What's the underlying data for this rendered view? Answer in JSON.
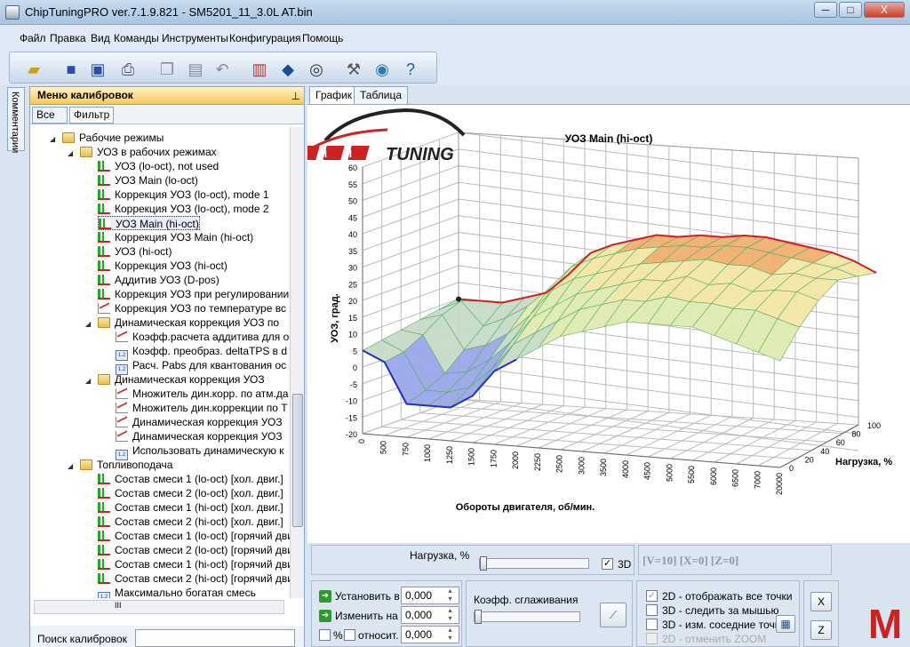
{
  "window": {
    "title": "ChipTuningPRO ver.7.1.9.821 - SM5201_11_3.0L AT.bin",
    "minimize": "─",
    "maximize": "□",
    "close": "X"
  },
  "menu": [
    "Файл",
    "Правка",
    "Вид",
    "Команды",
    "Инструменты",
    "Конфигурация",
    "Помощь"
  ],
  "toolbar": [
    "open-folder-icon",
    "save-icon",
    "save-as-icon",
    "print-icon",
    "copy-icon",
    "paste-icon",
    "undo-icon",
    "compare-icon",
    "info-icon",
    "search-map-icon",
    "settings-icon",
    "web-icon",
    "help-icon"
  ],
  "side_tab": "Комментарии",
  "left": {
    "header": "Меню калибровок",
    "pin": "⊥",
    "tabs": [
      "Все",
      "Фильтр"
    ],
    "tree": [
      {
        "t": "Рабочие режимы",
        "i": "folder",
        "lvl": 0,
        "exp": "◢"
      },
      {
        "t": "УОЗ в рабочих режимах",
        "i": "folder",
        "lvl": 1,
        "exp": "◢"
      },
      {
        "t": "УОЗ (lo-oct), not used",
        "i": "chart",
        "lvl": 2
      },
      {
        "t": "УОЗ Main (lo-oct)",
        "i": "chart",
        "lvl": 2
      },
      {
        "t": "Коррекция УОЗ (lo-oct), mode 1",
        "i": "chart",
        "lvl": 2
      },
      {
        "t": "Коррекция УОЗ (lo-oct), mode 2",
        "i": "chart",
        "lvl": 2
      },
      {
        "t": "УОЗ Main (hi-oct)",
        "i": "chart",
        "lvl": 2,
        "sel": true
      },
      {
        "t": "Коррекция УОЗ Main (hi-oct)",
        "i": "chart",
        "lvl": 2
      },
      {
        "t": "УОЗ (hi-oct)",
        "i": "chart",
        "lvl": 2
      },
      {
        "t": "Коррекция УОЗ (hi-oct)",
        "i": "chart",
        "lvl": 2
      },
      {
        "t": "Аддитив УОЗ (D-pos)",
        "i": "chart",
        "lvl": 2
      },
      {
        "t": "Коррекция УОЗ при регулировании",
        "i": "chart",
        "lvl": 2
      },
      {
        "t": "Коррекция УОЗ по температуре вс",
        "i": "curve",
        "lvl": 2
      },
      {
        "t": "Динамическая коррекция УОЗ по ",
        "i": "folder",
        "lvl": 2,
        "exp": "◢"
      },
      {
        "t": "Коэфф.расчета аддитива для о",
        "i": "curve",
        "lvl": 3
      },
      {
        "t": "Коэфф. преобраз. deltaTPS в d",
        "i": "num",
        "lvl": 3
      },
      {
        "t": "Расч. Pabs для квантования ос",
        "i": "num",
        "lvl": 3
      },
      {
        "t": "Динамическая коррекция УОЗ",
        "i": "folder",
        "lvl": 2,
        "exp": "◢"
      },
      {
        "t": "Множитель дин.корр. по атм.да",
        "i": "curve",
        "lvl": 3
      },
      {
        "t": "Множитель дин.коррекции по Т",
        "i": "curve",
        "lvl": 3
      },
      {
        "t": "Динамическая коррекция УОЗ",
        "i": "curve",
        "lvl": 3
      },
      {
        "t": "Динамическая коррекция УОЗ",
        "i": "curve",
        "lvl": 3
      },
      {
        "t": "Использовать динамическую к",
        "i": "num",
        "lvl": 3
      },
      {
        "t": "Топливоподача",
        "i": "folder",
        "lvl": 1,
        "exp": "◢"
      },
      {
        "t": "Состав смеси 1 (lo-oct) [хол. двиг.]",
        "i": "chart",
        "lvl": 2
      },
      {
        "t": "Состав смеси 2 (lo-oct) [хол. двиг.]",
        "i": "chart",
        "lvl": 2
      },
      {
        "t": "Состав смеси 1 (hi-oct) [хол. двиг.]",
        "i": "chart",
        "lvl": 2
      },
      {
        "t": "Состав смеси 2 (hi-oct) [хол. двиг.]",
        "i": "chart",
        "lvl": 2
      },
      {
        "t": "Состав смеси 1 (lo-oct) [горячий дви",
        "i": "chart",
        "lvl": 2
      },
      {
        "t": "Состав смеси 2 (lo-oct) [горячий дви",
        "i": "chart",
        "lvl": 2
      },
      {
        "t": "Состав смеси 1 (hi-oct) [горячий дви",
        "i": "chart",
        "lvl": 2
      },
      {
        "t": "Состав смеси 2 (hi-oct) [горячий дви",
        "i": "chart",
        "lvl": 2
      },
      {
        "t": "Максимально богатая смесь",
        "i": "num",
        "lvl": 2
      }
    ],
    "hscroll_label": "III",
    "search_label": "Поиск калибровок"
  },
  "right": {
    "tabs": [
      "График",
      "Таблица"
    ],
    "ctrl": {
      "load_label": "Нагрузка, %",
      "check_3d": "3D",
      "coords": "[V=10] [X=0] [Z=0]",
      "set_label": "Установить в",
      "set_value": "0,000",
      "change_label": "Изменить на",
      "change_value": "0,000",
      "pct_label": "%",
      "rel_label": "относит.",
      "rel_value": "0,000",
      "smooth_label": "Коэфф. сглаживания",
      "opt1": "2D - отображать все точки",
      "opt2": "3D - следить за мышью",
      "opt3": "3D - изм. соседние точки",
      "opt4": "2D - отменить ZOOM",
      "x_btn": "X",
      "z_btn": "Z"
    }
  },
  "chart_data": {
    "type": "surface3d",
    "title": "УОЗ Main (hi-oct)",
    "xlabel": "Обороты двигателя, об/мин.",
    "ylabel": "УОЗ, град.",
    "zlabel": "Нагрузка, %",
    "x_ticks": [
      "0",
      "500",
      "750",
      "1000",
      "1250",
      "1500",
      "1750",
      "2000",
      "2250",
      "2500",
      "3000",
      "3500",
      "4000",
      "4500",
      "5000",
      "5500",
      "6000",
      "6500",
      "7000",
      "20000"
    ],
    "z_ticks": [
      "0",
      "20",
      "40",
      "60",
      "80",
      "100"
    ],
    "y_ticks": [
      "-20",
      "-15",
      "-10",
      "-5",
      "0",
      "5",
      "10",
      "15",
      "20",
      "25",
      "30",
      "35",
      "40",
      "45",
      "50",
      "55",
      "60"
    ],
    "ylim": [
      -20,
      60
    ],
    "rows": [
      [
        10,
        10,
        10,
        12,
        14,
        20,
        27,
        30,
        32,
        34,
        34,
        35,
        35,
        36,
        36,
        35,
        34,
        33,
        31,
        28
      ],
      [
        9,
        12,
        5,
        8,
        12,
        18,
        25,
        28,
        30,
        32,
        33,
        34,
        34,
        35,
        35,
        34,
        33,
        32,
        31,
        29
      ],
      [
        8,
        10,
        0,
        2,
        6,
        12,
        20,
        24,
        26,
        28,
        30,
        31,
        32,
        33,
        32,
        32,
        30,
        31,
        30,
        30
      ],
      [
        7,
        6,
        -5,
        -4,
        0,
        6,
        14,
        18,
        22,
        24,
        26,
        28,
        28,
        30,
        28,
        29,
        27,
        28,
        28,
        26
      ],
      [
        6,
        3,
        -8,
        -8,
        -6,
        0,
        8,
        12,
        16,
        20,
        22,
        24,
        24,
        26,
        25,
        25,
        24,
        24,
        22,
        20
      ],
      [
        5,
        2,
        -10,
        -10,
        -10,
        -6,
        2,
        6,
        10,
        14,
        16,
        18,
        20,
        20,
        20,
        20,
        18,
        16,
        14,
        12
      ]
    ]
  },
  "logo": {
    "brand": "MMC TUNING",
    "letters": [
      "M",
      "M",
      "C"
    ],
    "tail": "TUNING",
    "corner_glyph": "M"
  }
}
